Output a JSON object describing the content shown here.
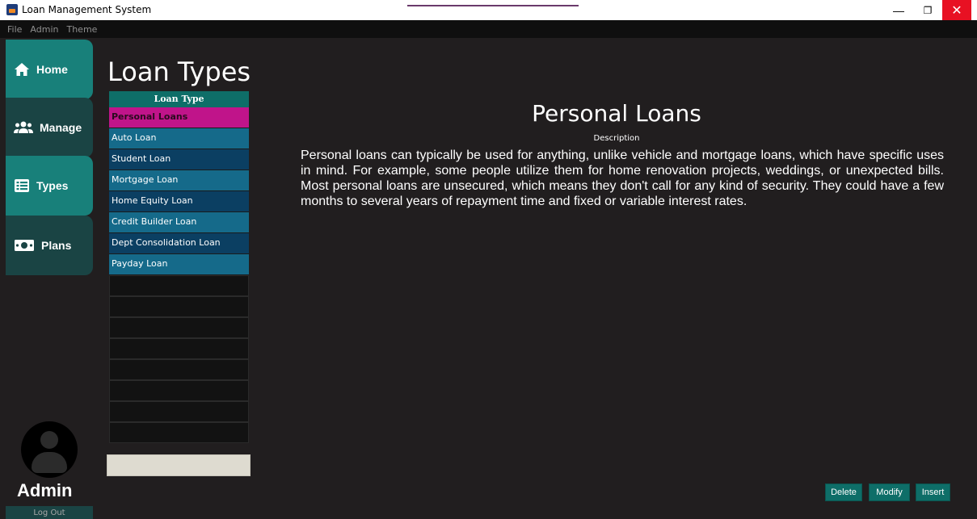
{
  "window": {
    "title": "Loan Management System",
    "minimize": "—",
    "maximize": "❐",
    "close": "✕"
  },
  "menu": [
    "File",
    "Admin",
    "Theme"
  ],
  "sidebar": {
    "items": [
      {
        "label": "Home",
        "icon": "home-icon"
      },
      {
        "label": "Manage",
        "icon": "users-icon"
      },
      {
        "label": "Types",
        "icon": "list-icon"
      },
      {
        "label": "Plans",
        "icon": "money-icon"
      }
    ],
    "user_name": "Admin",
    "logout_label": "Log Out"
  },
  "main": {
    "title": "Loan Types",
    "table": {
      "header": "Loan Type",
      "rows": [
        "Personal Loans",
        "Auto Loan",
        "Student Loan",
        "Mortgage Loan",
        "Home Equity Loan",
        "Credit Builder Loan",
        "Dept Consolidation Loan",
        "Payday Loan"
      ],
      "selected_index": 0
    },
    "input_value": ""
  },
  "detail": {
    "title": "Personal Loans",
    "description_label": "Description",
    "description": "Personal loans can typically be used for anything, unlike vehicle and mortgage loans, which have specific uses in mind. For example, some people utilize them for home renovation projects, weddings, or unexpected bills. Most personal loans are unsecured, which means they don't call for any kind of security. They could have a few months to several years of repayment time and fixed or variable interest rates."
  },
  "actions": {
    "delete": "Delete",
    "modify": "Modify",
    "insert": "Insert"
  },
  "colors": {
    "accent": "#18807a",
    "selected": "#c0148a",
    "row_light": "#156a8a",
    "row_dark": "#0b3f62",
    "background": "#211e1f"
  }
}
